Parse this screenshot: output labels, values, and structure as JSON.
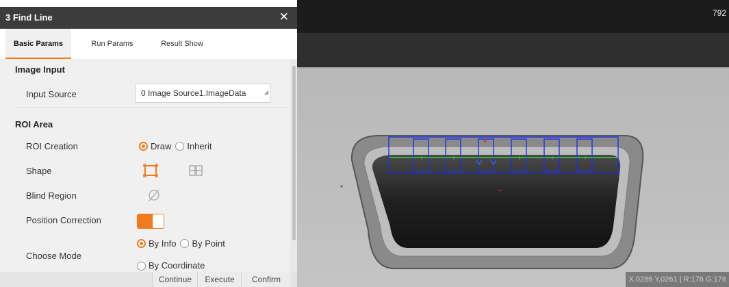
{
  "dialog": {
    "title": "3 Find Line",
    "close_glyph": "✕",
    "tabs": [
      "Basic Params",
      "Run Params",
      "Result Show"
    ],
    "active_tab": "Basic Params",
    "image_input": {
      "section": "Image Input",
      "input_source_label": "Input Source",
      "input_source_value": "0 Image Source1.ImageData"
    },
    "roi_area": {
      "section": "ROI Area",
      "roi_creation_label": "ROI Creation",
      "roi_options": [
        "Draw",
        "Inherit"
      ],
      "roi_selected": "Draw",
      "shape_label": "Shape",
      "shape_icons": [
        "rect-roi-icon",
        "multi-rect-roi-icon"
      ],
      "blind_region_label": "Blind Region",
      "blind_region_icon": "empty-set-icon",
      "position_correction_label": "Position Correction",
      "position_correction_on": true,
      "choose_mode_label": "Choose Mode",
      "mode_options": [
        "By Info",
        "By Point",
        "By Coordinate"
      ],
      "mode_selected": "By Info"
    },
    "footer": {
      "continue": "Continue",
      "execute": "Execute",
      "confirm": "Confirm"
    },
    "accent_color": "#f07a1c"
  },
  "image_view": {
    "counter": "792",
    "status": "X,0286  Y,0261  |  R:176  G:176"
  }
}
